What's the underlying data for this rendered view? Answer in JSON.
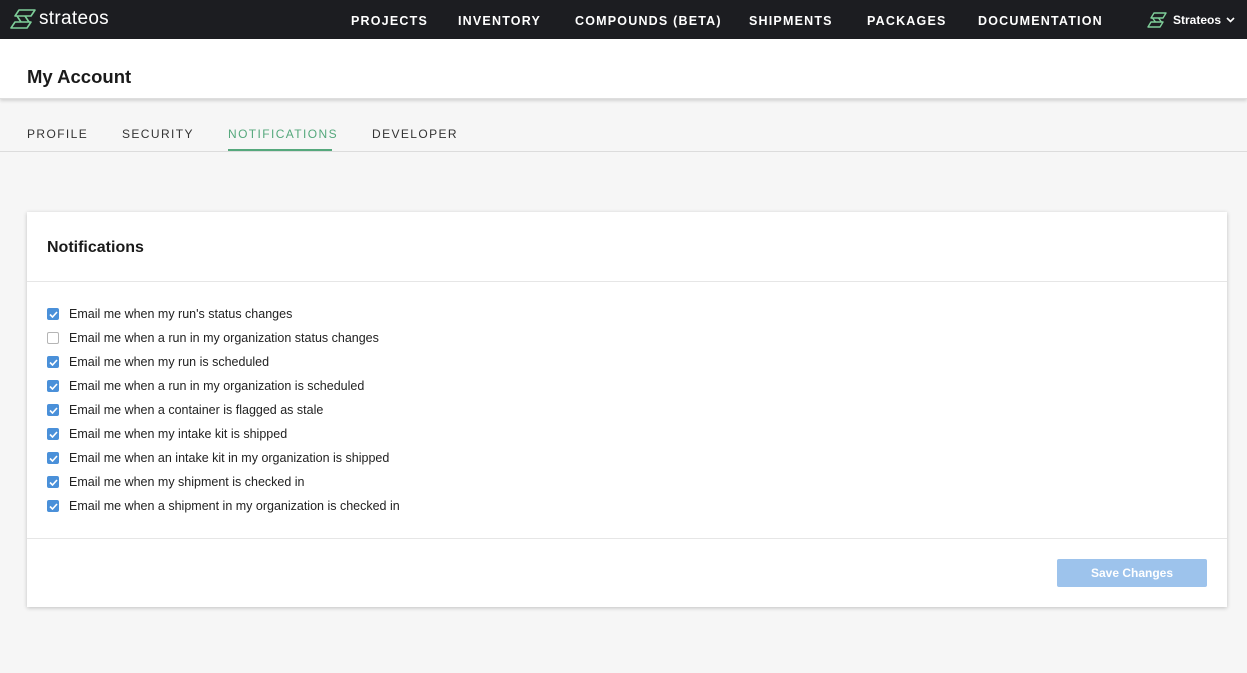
{
  "app": {
    "logo_text": "strateos",
    "logo_icon": "strateos-logo-icon"
  },
  "nav": {
    "items": [
      {
        "label": "PROJECTS"
      },
      {
        "label": "INVENTORY"
      },
      {
        "label": "COMPOUNDS (BETA)"
      },
      {
        "label": "SHIPMENTS"
      },
      {
        "label": "PACKAGES"
      },
      {
        "label": "DOCUMENTATION"
      }
    ],
    "account": {
      "name": "Strateos",
      "icon": "org-logo-icon",
      "chevron": "chevron-down-icon"
    }
  },
  "page": {
    "title": "My Account"
  },
  "tabs": [
    {
      "label": "PROFILE",
      "active": false
    },
    {
      "label": "SECURITY",
      "active": false
    },
    {
      "label": "NOTIFICATIONS",
      "active": true
    },
    {
      "label": "DEVELOPER",
      "active": false
    }
  ],
  "notifications": {
    "title": "Notifications",
    "options": [
      {
        "label": "Email me when my run's status changes",
        "checked": true
      },
      {
        "label": "Email me when a run in my organization status changes",
        "checked": false
      },
      {
        "label": "Email me when my run is scheduled",
        "checked": true
      },
      {
        "label": "Email me when a run in my organization is scheduled",
        "checked": true
      },
      {
        "label": "Email me when a container is flagged as stale",
        "checked": true
      },
      {
        "label": "Email me when my intake kit is shipped",
        "checked": true
      },
      {
        "label": "Email me when an intake kit in my organization is shipped",
        "checked": true
      },
      {
        "label": "Email me when my shipment is checked in",
        "checked": true
      },
      {
        "label": "Email me when a shipment in my organization is checked in",
        "checked": true
      }
    ],
    "save_label": "Save Changes"
  },
  "colors": {
    "nav_bg": "#1c1d21",
    "accent_green": "#55a87c",
    "checkbox_blue": "#4a90d9",
    "button_disabled": "#9dc3ec"
  }
}
